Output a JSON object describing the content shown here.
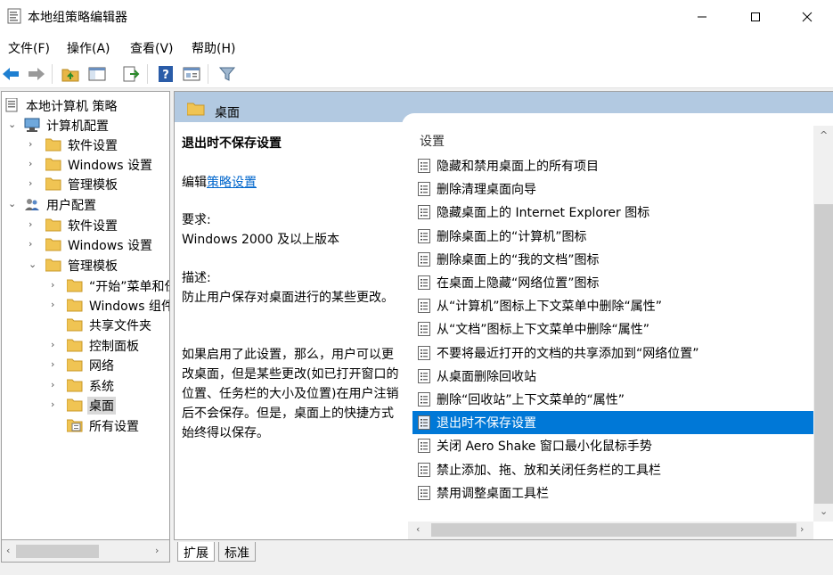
{
  "window": {
    "title": "本地组策略编辑器",
    "controls": [
      "minimize",
      "maximize",
      "close"
    ]
  },
  "menu": [
    "文件(F)",
    "操作(A)",
    "查看(V)",
    "帮助(H)"
  ],
  "toolbar": {
    "buttons": [
      "back-icon",
      "forward-icon",
      "up-folder-icon",
      "show-hide-tree-icon",
      "export-list-icon",
      "help-icon",
      "properties-icon",
      "filter-icon"
    ]
  },
  "tree": {
    "items": [
      {
        "label": "本地计算机 策略",
        "icon": "policy-doc-icon",
        "expander": ""
      },
      {
        "label": "计算机配置",
        "icon": "computer-icon",
        "expander": "open"
      },
      {
        "label": "软件设置",
        "icon": "folder-icon",
        "expander": "closed"
      },
      {
        "label": "Windows 设置",
        "icon": "folder-icon",
        "expander": "closed"
      },
      {
        "label": "管理模板",
        "icon": "folder-icon",
        "expander": "closed"
      },
      {
        "label": "用户配置",
        "icon": "users-icon",
        "expander": "open"
      },
      {
        "label": "软件设置",
        "icon": "folder-icon",
        "expander": "closed"
      },
      {
        "label": "Windows 设置",
        "icon": "folder-icon",
        "expander": "closed"
      },
      {
        "label": "管理模板",
        "icon": "folder-icon",
        "expander": "open"
      },
      {
        "label": "“开始”菜单和任",
        "icon": "folder-icon",
        "expander": "closed"
      },
      {
        "label": "Windows 组件",
        "icon": "folder-icon",
        "expander": "closed"
      },
      {
        "label": "共享文件夹",
        "icon": "folder-icon",
        "expander": ""
      },
      {
        "label": "控制面板",
        "icon": "folder-icon",
        "expander": "closed"
      },
      {
        "label": "网络",
        "icon": "folder-icon",
        "expander": "closed"
      },
      {
        "label": "系统",
        "icon": "folder-icon",
        "expander": "closed"
      },
      {
        "label": "桌面",
        "icon": "folder-icon",
        "expander": "closed",
        "selected": true
      },
      {
        "label": "所有设置",
        "icon": "all-settings-icon",
        "expander": ""
      }
    ]
  },
  "header": {
    "title": "桌面"
  },
  "description": {
    "title": "退出时不保存设置",
    "edit_prefix": "编辑",
    "edit_link": "策略设置",
    "req_label": "要求:",
    "req_value": "Windows 2000 及以上版本",
    "desc_label": "描述:",
    "desc_value": "防止用户保存对桌面进行的某些更改。",
    "detail": "如果启用了此设置，那么，用户可以更改桌面，但是某些更改(如已打开窗口的位置、任务栏的大小及位置)在用户注销后不会保存。但是，桌面上的快捷方式始终得以保存。"
  },
  "settings": {
    "column_header": "设置",
    "items": [
      "隐藏和禁用桌面上的所有项目",
      "删除清理桌面向导",
      "隐藏桌面上的 Internet Explorer 图标",
      "删除桌面上的“计算机”图标",
      "删除桌面上的“我的文档”图标",
      "在桌面上隐藏“网络位置”图标",
      "从“计算机”图标上下文菜单中删除“属性”",
      "从“文档”图标上下文菜单中删除“属性”",
      "不要将最近打开的文档的共享添加到“网络位置”",
      "从桌面删除回收站",
      "删除“回收站”上下文菜单的“属性”",
      "退出时不保存设置",
      "关闭 Aero Shake 窗口最小化鼠标手势",
      "禁止添加、拖、放和关闭任务栏的工具栏",
      "禁用调整桌面工具栏"
    ],
    "selected": "退出时不保存设置"
  },
  "tabs": [
    "扩展",
    "标准"
  ],
  "colors": {
    "header_band": "#b2c9e1",
    "selection": "#0078d7",
    "link": "#0066cc"
  }
}
